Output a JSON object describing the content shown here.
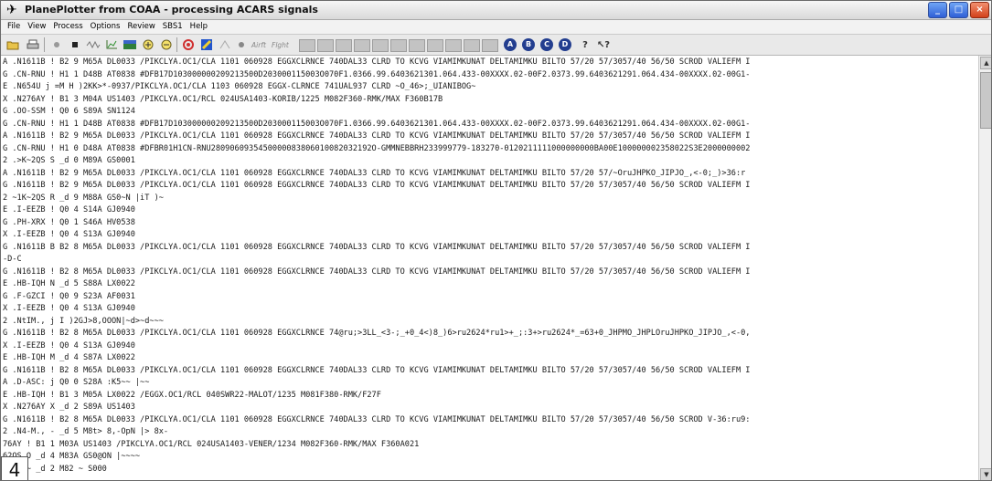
{
  "window": {
    "title": "PlanePlotter from COAA - processing ACARS signals",
    "controls": {
      "minimize": "_",
      "maximize": "□",
      "close": "×"
    }
  },
  "menu": [
    "File",
    "View",
    "Process",
    "Options",
    "Review",
    "SBS1",
    "Help"
  ],
  "toolbar": {
    "airfit_label": "Airft",
    "flight_label": "Flght",
    "circle_buttons": [
      "A",
      "B",
      "C",
      "D"
    ],
    "help_icon": "question-icon",
    "context_help_icon": "pointer-help-icon"
  },
  "log_lines": [
    "A .N1611B ! B2 9 M65A DL0033 /PIKCLYA.OC1/CLA 1101 060928 EGGXCLRNCE 740DAL33 CLRD TO KCVG VIAMIMKUNAT DELTAMIMKU BILTO 57/20 57/3057/40 56/50 SCROD VALIEFM I",
    "G .CN-RNU ! H1 1 D48B AT0838 #DFB17D103000000209213500D203000115003O070F1.0366.99.6403621301.064.433-00XXXX.02-00F2.0373.99.6403621291.064.434-00XXXX.02-00G1-",
    "E .N654U j =M H )2KK>*-0937/PIKCLYA.OC1/CLA 1103 060928 EGGX-CLRNCE 741UAL937 CLRD ~O_46>;_UIANIBOG~",
    "X .N276AY ! B1 3 M04A US1403 /PIKCLYA.OC1/RCL 024USA1403-KORIB/1225 M082F360-RMK/MAX F360B17B",
    "G .OO-SSM ! Q0 6 S89A SN1124",
    "G .CN-RNU ! H1 1 D48B AT0838 #DFB17D103000000209213500D203000115003O070F1.0366.99.6403621301.064.433-00XXXX.02-00F2.0373.99.6403621291.064.434-00XXXX.02-00G1-",
    "A .N1611B ! B2 9 M65A DL0033 /PIKCLYA.OC1/CLA 1101 060928 EGGXCLRNCE 740DAL33 CLRD TO KCVG VIAMIMKUNAT DELTAMIMKU BILTO 57/20 57/3057/40 56/50 SCROD VALIEFM I",
    "G .CN-RNU ! H1 0 D48A AT0838 #DFBR01H1CN-RNU2809060935450000083806010082032192O-GMMNEBBRH233999779-183270-0120211111000000000BA00E100000002358022S3E2000000002",
    "2 .>K~2QS S _d 0 M89A GS0001",
    "A .N1611B ! B2 9 M65A DL0033 /PIKCLYA.OC1/CLA 1101 060928 EGGXCLRNCE 740DAL33 CLRD TO KCVG VIAMIMKUNAT DELTAMIMKU BILTO 57/20 57/~OruJHPKO_JIPJO_,<-0;_)>36:r",
    "G .N1611B ! B2 9 M65A DL0033 /PIKCLYA.OC1/CLA 1101 060928 EGGXCLRNCE 740DAL33 CLRD TO KCVG VIAMIMKUNAT DELTAMIMKU BILTO 57/20 57/3057/40 56/50 SCROD VALIEFM I",
    "2 ~1K~2QS R _d 9 M88A GS0~N |iT )~",
    "E .I-EEZB ! Q0 4 S14A GJ0940",
    "G .PH-XRX ! Q0 1 S46A HV0538",
    "X .I-EEZB ! Q0 4 S13A GJ0940",
    "G .N1611B B B2 8 M65A DL0033 /PIKCLYA.OC1/CLA 1101 060928 EGGXCLRNCE 740DAL33 CLRD TO KCVG VIAMIMKUNAT DELTAMIMKU BILTO 57/20 57/3057/40 56/50 SCROD VALIEFM I",
    " -D-C",
    "G .N1611B ! B2 8 M65A DL0033 /PIKCLYA.OC1/CLA 1101 060928 EGGXCLRNCE 740DAL33 CLRD TO KCVG VIAMIMKUNAT DELTAMIMKU BILTO 57/20 57/3057/40 56/50 SCROD VALIEFM I",
    "E .HB-IQH N _d 5 S88A LX0022",
    "G .F-GZCI ! Q0 9 S23A AF0031",
    "X .I-EEZB ! Q0 4 S13A GJ0940",
    "2 .NtIM., j   I )2GJ>8,OOON|~d>~d~~~",
    "G .N1611B ! B2 8 M65A DL0033 /PIKCLYA.OC1/CLA 1101 060928 EGGXCLRNCE 74@ru;>3LL_<3-;_+0_4<)8_)6>ru2624*ru1>+_;:3+>ru2624*_=63+0_JHPMO_JHPLOruJHPKO_JIPJO_,<-0,",
    "X .I-EEZB ! Q0 4 S13A GJ0940",
    "E .HB-IQH M _d 4 S87A LX0022",
    "G .N1611B ! B2 8 M65A DL0033 /PIKCLYA.OC1/CLA 1101 060928 EGGXCLRNCE 740DAL33 CLRD TO KCVG VIAMIMKUNAT DELTAMIMKU BILTO 57/20 57/3057/40 56/50 SCROD VALIEFM I",
    "A .D-ASC: j Q0 0 S28A :K5~~ |~~",
    "E .HB-IQH ! B1 3 M05A LX0022 /EGGX.OC1/RCL 040SWR22-MALOT/1235 M081F380-RMK/F27F",
    "X .N276AY X _d 2 S89A US1403",
    "G .N1611B ! B2 8 M65A DL0033 /PIKCLYA.OC1/CLA 1101 060928 EGGXCLRNCE 740DAL33 CLRD TO KCVG VIAMIMKUNAT DELTAMIMKU BILTO 57/20 57/3057/40 56/50 SCROD V-36:ru9:",
    "2 .N4-M., - _d 5 M8t> 8,-OpN |> 8x-",
    "  76AY ! B1 1 M03A US1403 /PIKCLYA.OC1/RCL 024USA1403-VENER/1234 M082F360-RMK/MAX F360A021",
    "  62QS O _d 4 M83A GS0@ON |~~~~",
    "  62QS ~ _d 2 M82 ~ S000"
  ],
  "figure_label": "4"
}
